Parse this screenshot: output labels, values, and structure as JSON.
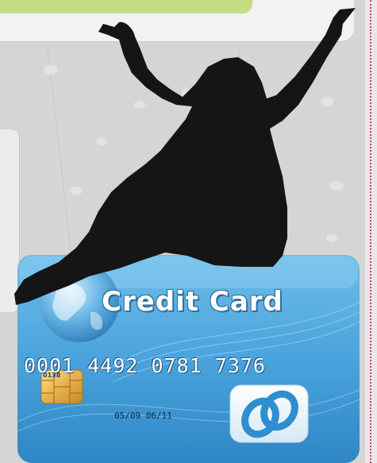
{
  "card": {
    "title": "Credit Card",
    "number": "0001 4492 0781 7376",
    "small_code": "0138",
    "dates": "05/09 06/11"
  },
  "colors": {
    "background": "#d4d5d4",
    "top_panel": "#f2f2f1",
    "green_bar": "#c3dd84",
    "card_blue": "#4aa3dc",
    "silhouette": "#151515",
    "dotted_line": "#d83d5a"
  },
  "icons": {
    "chip": "chip-icon",
    "globe": "globe-icon",
    "logo": "card-logo-icon"
  }
}
